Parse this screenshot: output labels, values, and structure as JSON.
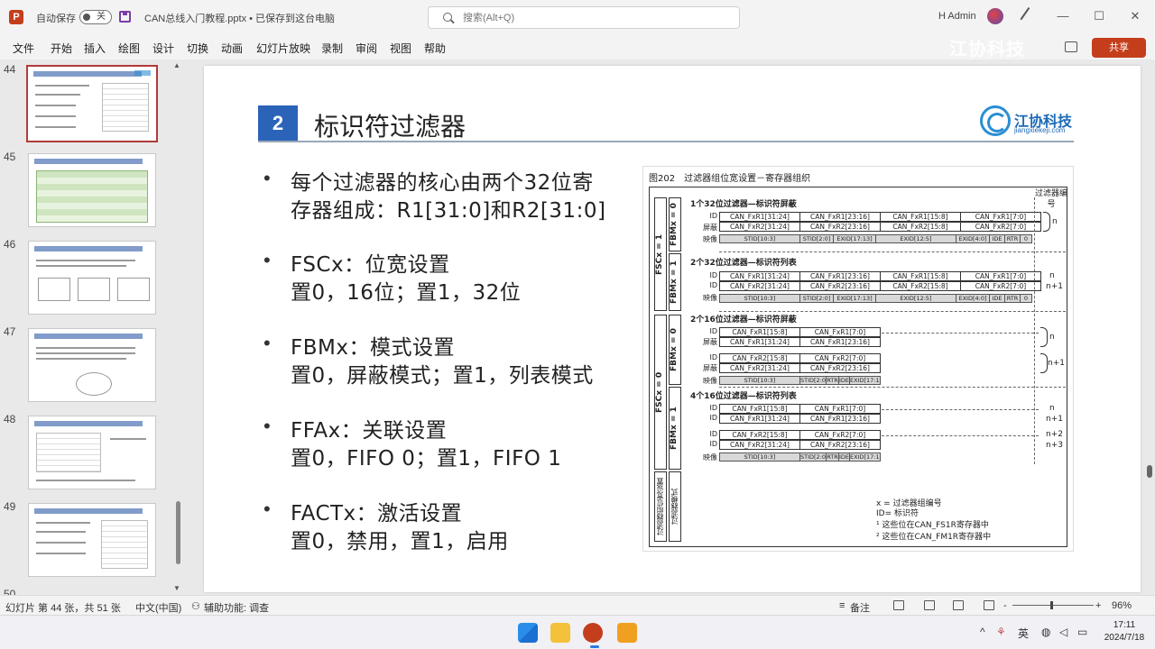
{
  "titlebar": {
    "app_letter": "P",
    "autosave_label": "自动保存",
    "autosave_state": "关",
    "doc_title": "CAN总线入门教程.pptx • 已保存到这台电脑",
    "search_placeholder": "搜索(Alt+Q)",
    "user_name": "H Admin"
  },
  "ribbon": {
    "tabs": [
      "文件",
      "开始",
      "插入",
      "绘图",
      "设计",
      "切换",
      "动画",
      "幻灯片放映",
      "录制",
      "审阅",
      "视图",
      "帮助"
    ],
    "watermark": "江协科技",
    "share_label": "共享"
  },
  "thumbnails": {
    "numbers": [
      "44",
      "45",
      "46",
      "47",
      "48",
      "49",
      "50"
    ],
    "active": "44"
  },
  "slide": {
    "number_badge": "2",
    "title": "标识符过滤器",
    "logo_name": "江协科技",
    "logo_url": "jiangxiekeji.com",
    "bullets": [
      {
        "lines": [
          "每个过滤器的核心由两个32位寄",
          "存器组成：R1[31:0]和R2[31:0]"
        ]
      },
      {
        "lines": [
          "FSCx：位宽设置",
          "置0，16位；置1，32位"
        ]
      },
      {
        "lines": [
          "FBMx：模式设置",
          "置0，屏蔽模式；置1，列表模式"
        ]
      },
      {
        "lines": [
          "FFAx：关联设置",
          "置0，FIFO 0；置1，FIFO 1"
        ]
      },
      {
        "lines": [
          "FACTx：激活设置",
          "置0，禁用，置1，启用"
        ]
      }
    ],
    "figure": {
      "caption": "图202　过滤器组位宽设置－寄存器组织",
      "filter_no_header": "过滤器编号",
      "fscx1": "FSCx = 1",
      "fscx0": "FSCx = 0",
      "fbmx0": "FBMx = 0",
      "fbmx1": "FBMx = 1",
      "left_label_1": "过滤器组位宽设置",
      "left_label_1b": "配置位",
      "left_label_2": "过滤器模式",
      "left_label_2b": "配置位",
      "sections": [
        "1个32位过滤器—标识符屏蔽",
        "2个32位过滤器—标识符列表",
        "2个16位过滤器—标识符屏蔽",
        "4个16位过滤器—标识符列表"
      ],
      "row_labels": {
        "id": "ID",
        "mask": "屏蔽",
        "map": "映像"
      },
      "cells_32": [
        "CAN_FxR1[31:24]",
        "CAN_FxR1[23:16]",
        "CAN_FxR1[15:8]",
        "CAN_FxR1[7:0]"
      ],
      "cells_32b": [
        "CAN_FxR2[31:24]",
        "CAN_FxR2[23:16]",
        "CAN_FxR2[15:8]",
        "CAN_FxR2[7:0]"
      ],
      "map_32": [
        "STID[10:3]",
        "STID[2:0]",
        "EXID[17:13]",
        "EXID[12:5]",
        "EXID[4:0]",
        "IDE",
        "RTR",
        "0"
      ],
      "cells_16a": [
        "CAN_FxR1[15:8]",
        "CAN_FxR1[7:0]"
      ],
      "cells_16b": [
        "CAN_FxR1[31:24]",
        "CAN_FxR1[23:16]"
      ],
      "cells_16c": [
        "CAN_FxR2[15:8]",
        "CAN_FxR2[7:0]"
      ],
      "cells_16d": [
        "CAN_FxR2[31:24]",
        "CAN_FxR2[23:16]"
      ],
      "map_16": [
        "STID[10:3]",
        "STID[2:0]",
        "RTR",
        "IDE",
        "EXID[17:15]"
      ],
      "n_labels": [
        "n",
        "n",
        "n+1",
        "n",
        "n+1",
        "n",
        "n+1",
        "n+2",
        "n+3"
      ],
      "legend": [
        "x = 过滤器组编号",
        "ID= 标识符",
        "¹ 这些位在CAN_FS1R寄存器中",
        "² 这些位在CAN_FM1R寄存器中"
      ]
    }
  },
  "statusbar": {
    "slide_info": "幻灯片 第 44 张，共 51 张",
    "language": "中文(中国)",
    "accessibility": "辅助功能: 调查",
    "notes": "备注",
    "zoom": "96%",
    "minus": "-",
    "plus": "+"
  },
  "taskbar": {
    "ime": "英",
    "time": "17:11",
    "date": "2024/7/18"
  }
}
